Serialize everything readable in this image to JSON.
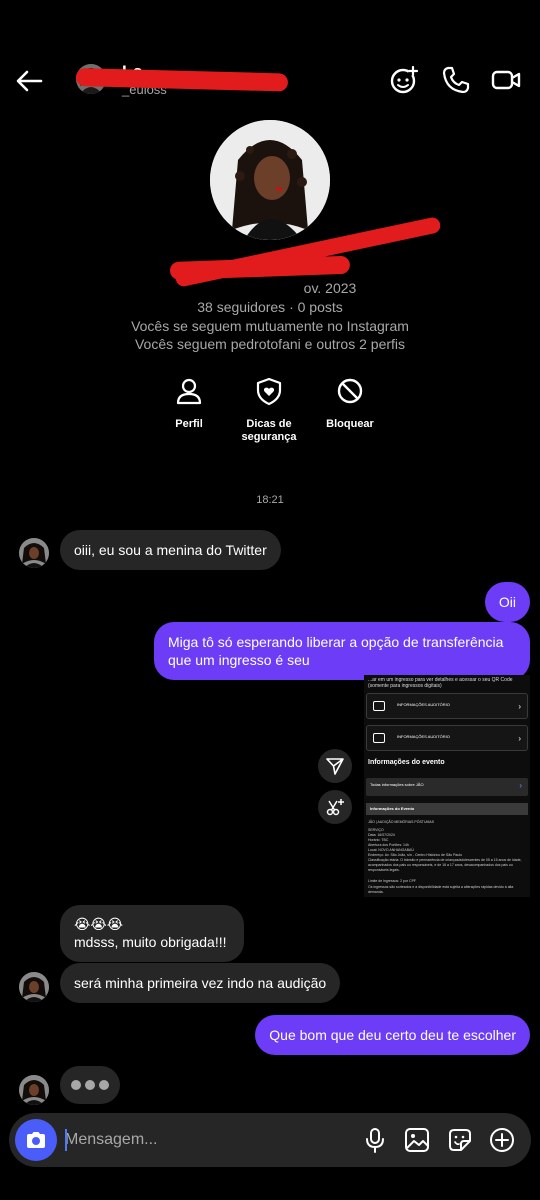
{
  "header": {
    "username": "_euloss",
    "icons": [
      "back-arrow-icon",
      "effects-icon",
      "phone-icon",
      "video-icon"
    ]
  },
  "profile": {
    "handle_date": "ov. 2023",
    "stats": "seguidores · 0 posts",
    "mutual": "Vocês se seguem mutuamente no Instagram",
    "followers_in_common": "Vocês seguem pedrotofani e outros 2 perfis",
    "actions": [
      {
        "label": "Perfil",
        "icon": "person-icon"
      },
      {
        "label": "Dicas de segurança",
        "icon": "shield-icon"
      },
      {
        "label": "Bloquear",
        "icon": "block-icon"
      }
    ]
  },
  "chat": {
    "timestamp": "18:21",
    "messages": [
      {
        "from": "them",
        "text": "oiii, eu sou a menina do Twitter"
      },
      {
        "from": "me",
        "text": "Oii"
      },
      {
        "from": "me",
        "text": "Miga tô só esperando liberar a opção de transferência que um ingresso é seu"
      },
      {
        "from": "them",
        "text": "😭😭😭"
      },
      {
        "from": "them",
        "text": "mdsss, muito obrigada!!!"
      },
      {
        "from": "them",
        "text": "será minha primeira vez indo na audição"
      },
      {
        "from": "me",
        "text": "Que bom que deu certo deu te escolher"
      }
    ],
    "shared_screenshot": {
      "intro": "...ar em um ingresso para ver detalhes e acessar o seu QR Code (somente para ingressos digitais)",
      "cards": [
        "INFORMAÇÕES AUDITÓRIO",
        "INFORMAÇÕES AUDITÓRIO"
      ],
      "section_title": "Informações do evento",
      "all_info": "Todas informações sobre JÃO",
      "band_title": "Informações do Evento",
      "event_line": "JÃO | AUDIÇÃO MEMÓRIAS PÓSTUMAS",
      "details": [
        "SERVIÇO",
        "Data: 16/07/2024",
        "Horário: TBC",
        "Abertura dos Portões: 14h",
        "Local: NOVO ANHANGABAÚ",
        "Endereço: Av. São João, s/n - Centro Histórico de São Paulo",
        "Classificação etária: O trânsito e permanência de crianças/adolescentes de 05 a 15 anos de idade, acompanhados dos pais ou responsáveis, e de 16 a 17 anos, desacompanhados dos pais ou responsáveis legais.",
        "Limite de ingressos: 2 por CPF",
        "Os ingressos são sorteados e a disponibilidade está sujeita a alterações rápidas devido à alta demanda."
      ]
    }
  },
  "composer": {
    "placeholder": "Mensagem...",
    "icons": [
      "camera-icon",
      "microphone-icon",
      "gallery-icon",
      "sticker-icon",
      "add-icon"
    ]
  },
  "colors": {
    "background": "#000000",
    "incoming_bubble": "#262626",
    "outgoing_bubble": "#6d3cf7",
    "camera_button": "#4a5df9",
    "redaction": "#e21c1c"
  }
}
